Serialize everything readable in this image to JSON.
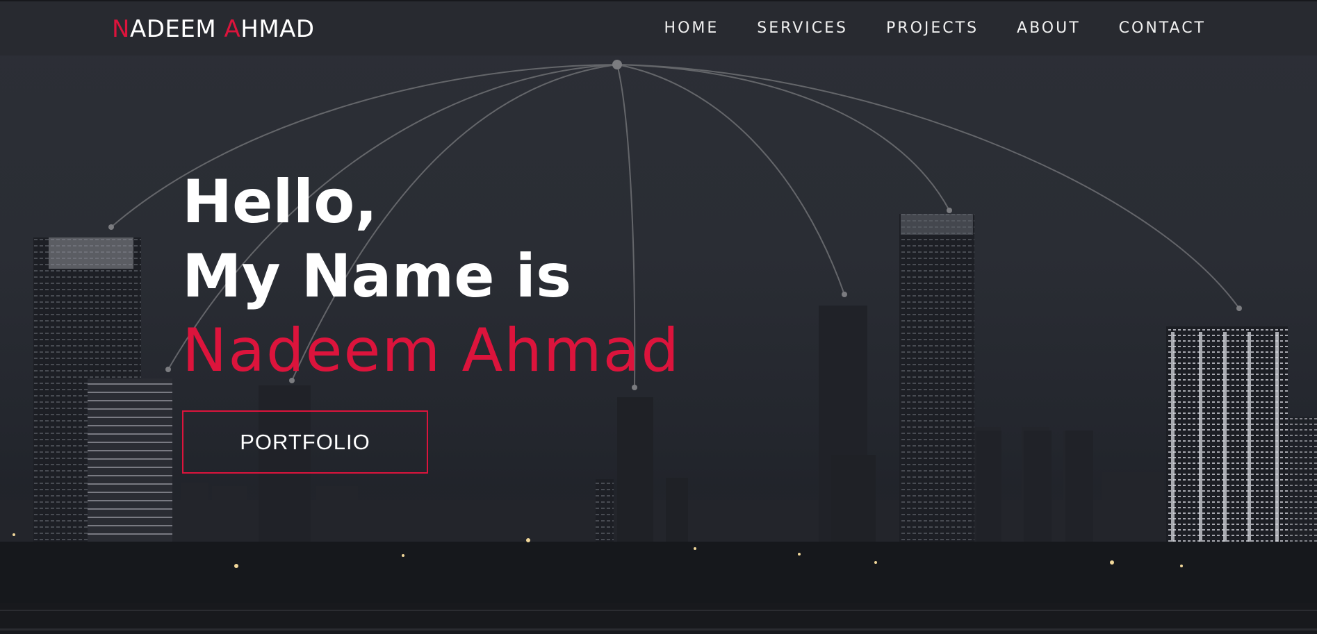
{
  "brand": {
    "first_initial": "N",
    "first_rest": "ADEEM ",
    "last_initial": "A",
    "last_rest": "HMAD",
    "accent_color": "#dc143c"
  },
  "nav": {
    "items": [
      {
        "label": "HOME"
      },
      {
        "label": "SERVICES"
      },
      {
        "label": "PROJECTS"
      },
      {
        "label": "ABOUT"
      },
      {
        "label": "CONTACT"
      }
    ]
  },
  "hero": {
    "greeting": "Hello,",
    "intro": "My Name is",
    "name": "Nadeem Ahmad",
    "button_label": "PORTFOLIO"
  },
  "colors": {
    "background": "#2a2d34",
    "text": "#ffffff",
    "accent": "#dc143c"
  }
}
